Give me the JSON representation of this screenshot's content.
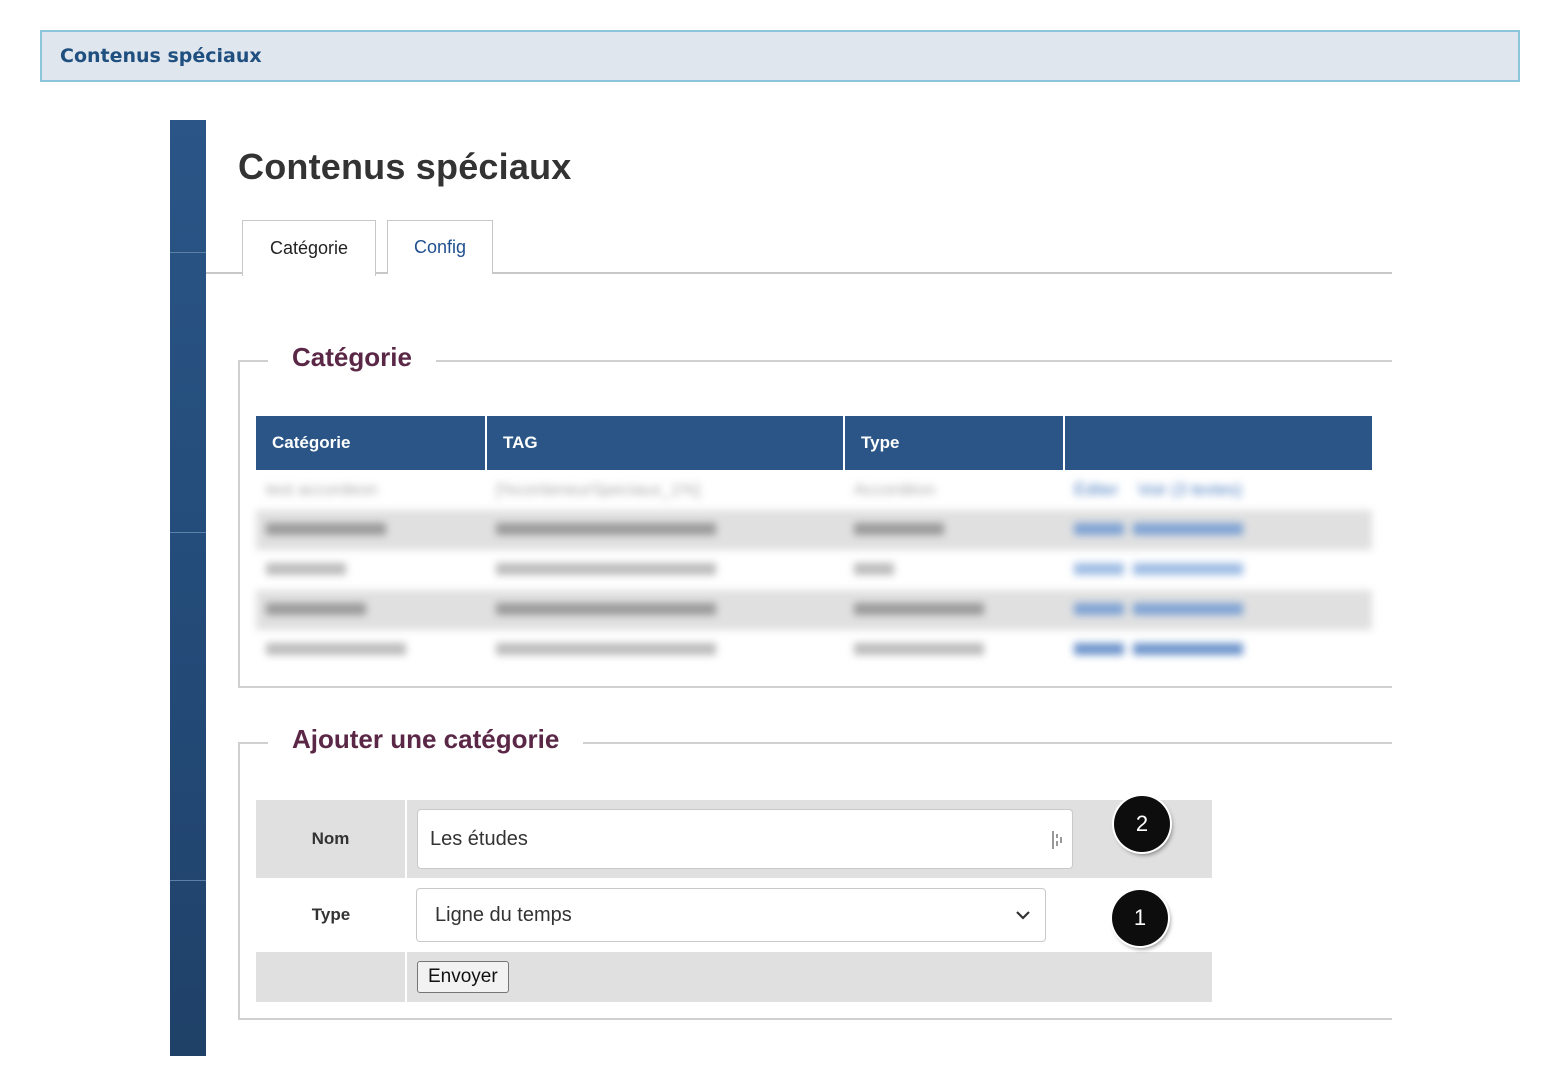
{
  "banner": {
    "title": "Contenus spéciaux"
  },
  "page": {
    "title": "Contenus spéciaux"
  },
  "tabs": [
    {
      "label": "Catégorie",
      "active": true
    },
    {
      "label": "Config",
      "active": false
    }
  ],
  "category_section": {
    "legend": "Catégorie",
    "columns": [
      "Catégorie",
      "TAG",
      "Type",
      ""
    ],
    "rows": [
      {
        "name": "test accordeon",
        "tag": "[%conteneurSpeciaux_1%]",
        "type": "Accordéon",
        "edit": "Éditer",
        "view": "Voir (3 textes)"
      }
    ],
    "blurred_row_count": 4
  },
  "add_section": {
    "legend": "Ajouter une catégorie",
    "name_label": "Nom",
    "name_value": "Les études",
    "type_label": "Type",
    "type_value": "Ligne du temps",
    "submit_label": "Envoyer"
  },
  "markers": {
    "one": "1",
    "two": "2"
  },
  "colors": {
    "header_blue": "#2a5586",
    "legend_purple": "#5a2746",
    "banner_border": "#8cc6da"
  }
}
